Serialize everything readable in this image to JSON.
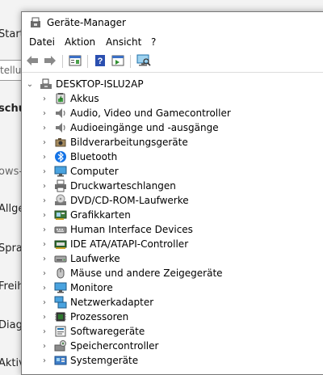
{
  "background": {
    "texts": [
      "Start",
      "tellu",
      "schu",
      "ows-",
      "Allge",
      "Sprac",
      "Freih",
      "Diagn",
      "Aktiv"
    ]
  },
  "window": {
    "title": "Geräte-Manager",
    "menu": [
      "Datei",
      "Aktion",
      "Ansicht",
      "?"
    ],
    "toolbar_icons": [
      "back-icon",
      "forward-icon",
      "properties-icon",
      "help-icon",
      "show-hidden-icon",
      "scan-hardware-icon"
    ]
  },
  "tree": {
    "root": "DESKTOP-ISLU2AP",
    "items": [
      {
        "label": "Akkus",
        "icon": "battery-icon"
      },
      {
        "label": "Audio, Video und Gamecontroller",
        "icon": "speaker-icon"
      },
      {
        "label": "Audioeingänge und -ausgänge",
        "icon": "speaker-icon"
      },
      {
        "label": "Bildverarbeitungsgeräte",
        "icon": "camera-icon"
      },
      {
        "label": "Bluetooth",
        "icon": "bluetooth-icon"
      },
      {
        "label": "Computer",
        "icon": "monitor-icon"
      },
      {
        "label": "Druckwarteschlangen",
        "icon": "printer-icon"
      },
      {
        "label": "DVD/CD-ROM-Laufwerke",
        "icon": "disc-icon"
      },
      {
        "label": "Grafikkarten",
        "icon": "display-adapter-icon"
      },
      {
        "label": "Human Interface Devices",
        "icon": "hid-icon"
      },
      {
        "label": "IDE ATA/ATAPI-Controller",
        "icon": "ide-controller-icon"
      },
      {
        "label": "Laufwerke",
        "icon": "drive-icon"
      },
      {
        "label": "Mäuse und andere Zeigegeräte",
        "icon": "mouse-icon"
      },
      {
        "label": "Monitore",
        "icon": "monitor-icon"
      },
      {
        "label": "Netzwerkadapter",
        "icon": "network-icon"
      },
      {
        "label": "Prozessoren",
        "icon": "cpu-icon"
      },
      {
        "label": "Softwaregeräte",
        "icon": "software-device-icon"
      },
      {
        "label": "Speichercontroller",
        "icon": "storage-controller-icon"
      },
      {
        "label": "Systemgeräte",
        "icon": "system-device-icon"
      }
    ]
  }
}
